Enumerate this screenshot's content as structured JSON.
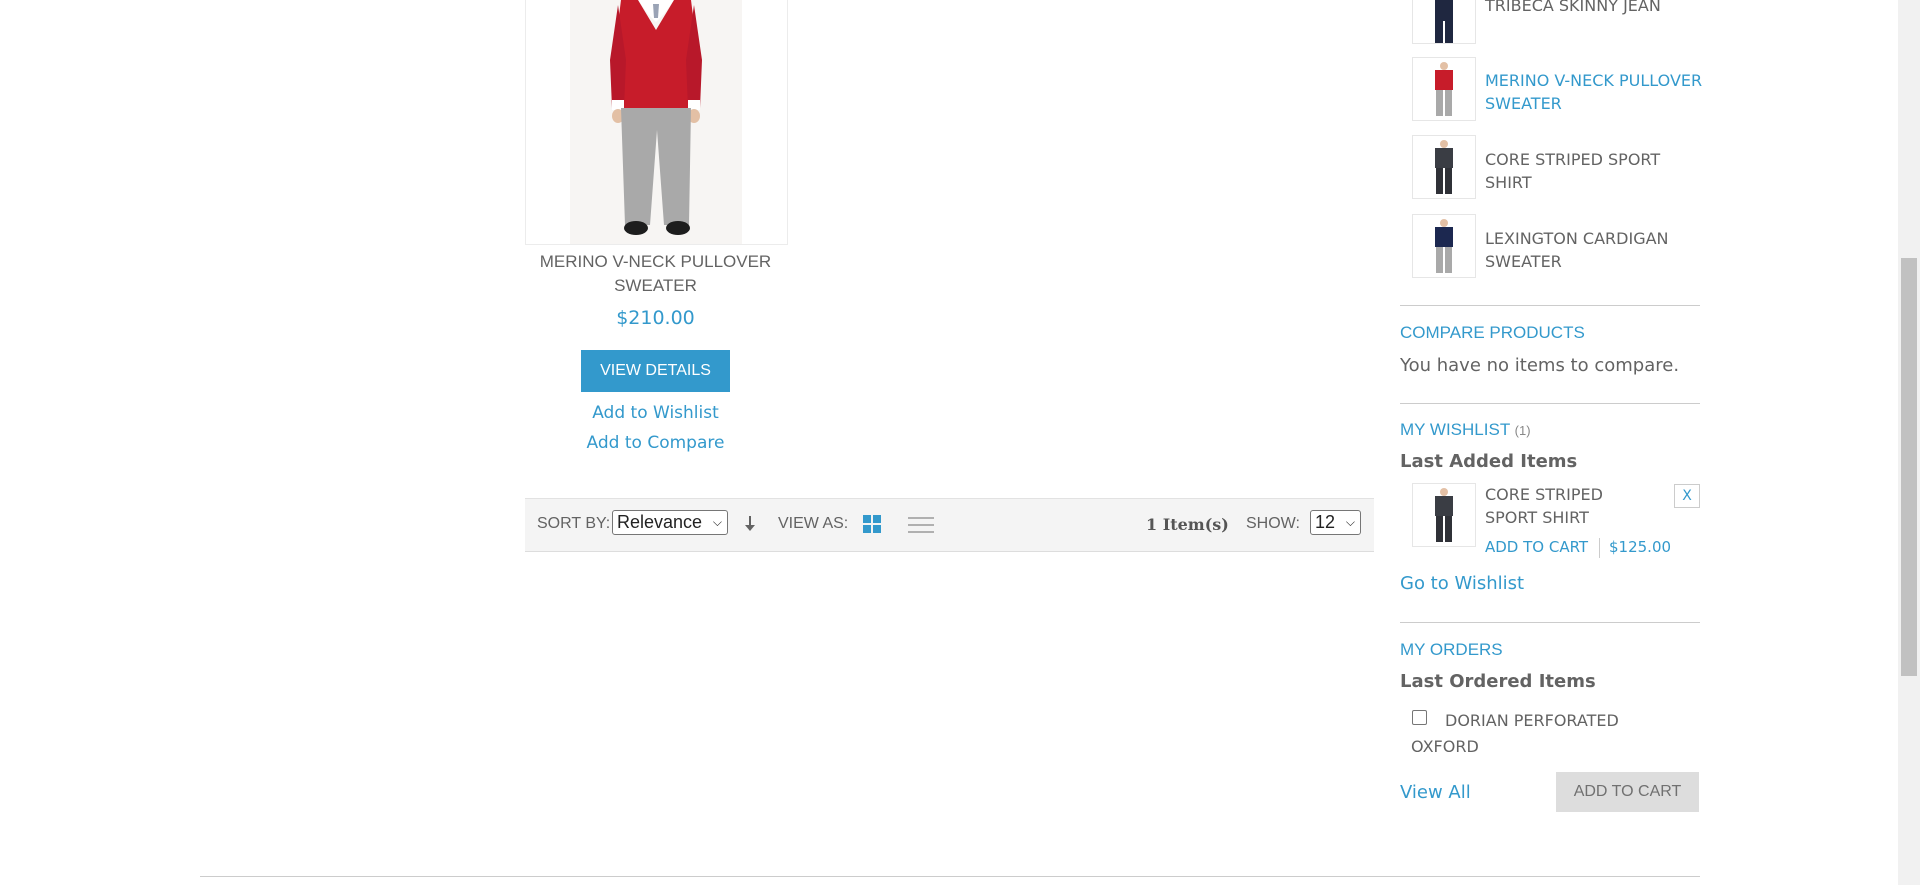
{
  "product": {
    "name": "MERINO V-NECK PULLOVER SWEATER",
    "price": "$210.00",
    "view_details": "VIEW DETAILS",
    "add_to_wishlist": "Add to Wishlist",
    "add_to_compare": "Add to Compare"
  },
  "toolbar": {
    "sort_by_label": "SORT BY:",
    "sort_value": "Relevance",
    "view_as_label": "VIEW AS:",
    "items_count": "1 Item(s)",
    "show_label": "SHOW:",
    "limit_value": "12"
  },
  "sidebar": {
    "recently_viewed": [
      {
        "name": "TRIBECA SKINNY JEAN",
        "active": false
      },
      {
        "name": "MERINO V-NECK PULLOVER SWEATER",
        "active": true
      },
      {
        "name": "CORE STRIPED SPORT SHIRT",
        "active": false
      },
      {
        "name": "LEXINGTON CARDIGAN SWEATER",
        "active": false
      }
    ],
    "compare": {
      "title": "COMPARE PRODUCTS",
      "empty_text": "You have no items to compare."
    },
    "wishlist": {
      "title": "MY WISHLIST",
      "count": "(1)",
      "subtitle": "Last Added Items",
      "item_name": "CORE STRIPED SPORT SHIRT",
      "remove": "X",
      "add_to_cart": "ADD TO CART",
      "price": "$125.00",
      "go_to_wishlist": "Go to Wishlist"
    },
    "orders": {
      "title": "MY ORDERS",
      "subtitle": "Last Ordered Items",
      "item_name": "DORIAN PERFORATED OXFORD",
      "view_all": "View All",
      "add_to_cart": "ADD TO CART"
    }
  },
  "colors": {
    "accent": "#3399cc",
    "text": "#636363",
    "toolbar_bg": "#f4f4f4"
  }
}
